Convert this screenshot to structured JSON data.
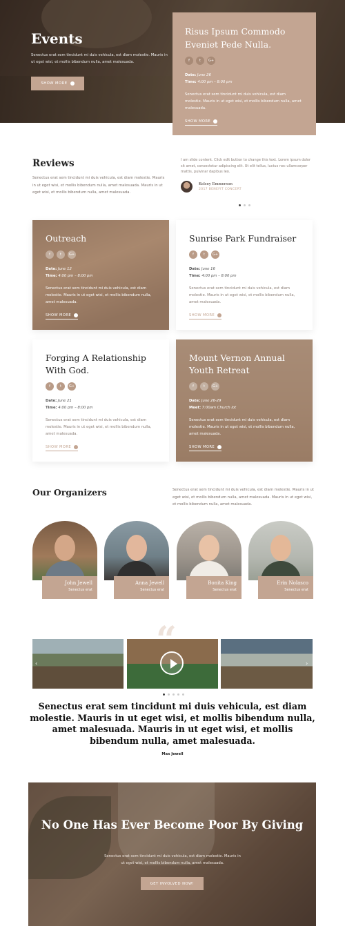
{
  "hero": {
    "title": "Events",
    "text": "Senectus erat sem tincidunt mi duis vehicula, est diam molestie. Mauris in ut eget wisi, et mollis bibendum nulla, amet malesuada.",
    "button": "Show More",
    "card": {
      "title": "Risus Ipsum Commodo Eveniet Pede Nulla.",
      "date_label": "Date:",
      "date": "June 26",
      "time_label": "Time:",
      "time": "4:00 pm – 8:00 pm",
      "text": "Senectus erat sem tincidunt mi duis vehicula, est diam molestie. Mauris in ut eget wisi, et mollis bibendum nulla, amet malesuada.",
      "link": "Show More"
    }
  },
  "reviews": {
    "title": "Reviews",
    "text": "Senectus erat sem tincidunt mi duis vehicula, est diam molestie. Mauris in ut eget wisi, et mollis bibendum nulla, amet malesuada. Mauris in ut eget wisi, et mollis bibendum nulla, amet malesuada.",
    "testimonial": "I am slide content. Click edit button to change this text. Lorem ipsum dolor sit amet, consectetur adipiscing elit. Ut elit tellus, luctus nec ullamcorper mattis, pulvinar dapibus leo.",
    "author_name": "Kelsey Emmerson",
    "author_role": "2017 Benefit Concert"
  },
  "events": [
    {
      "title": "Outreach",
      "date_label": "Date:",
      "date": "June 12",
      "time_label": "Time:",
      "time": "4:00 pm – 8:00 pm",
      "text": "Senectus erat sem tincidunt mi duis vehicula, est diam molestie. Mauris in ut eget wisi, et mollis bibendum nulla, amet malesuada.",
      "link": "Show More"
    },
    {
      "title": "Sunrise Park Fundraiser",
      "date_label": "Date:",
      "date": "June 16",
      "time_label": "Time:",
      "time": "4:00 pm – 8:00 pm",
      "text": "Senectus erat sem tincidunt mi duis vehicula, est diam molestie. Mauris in ut eget wisi, et mollis bibendum nulla, amet malesuada.",
      "link": "Show More"
    },
    {
      "title": "Forging A Relationship With God.",
      "date_label": "Date:",
      "date": "June 21",
      "time_label": "Time:",
      "time": "4:00 pm – 8:00 pm",
      "text": "Senectus erat sem tincidunt mi duis vehicula, est diam molestie. Mauris in ut eget wisi, et mollis bibendum nulla, amet malesuada.",
      "link": "Show More"
    },
    {
      "title": "Mount Vernon Annual Youth Retreat",
      "date_label": "Date:",
      "date": "June 26-29",
      "time_label": "Meet:",
      "time": "7:00am Church lot",
      "text": "Senectus erat sem tincidunt mi duis vehicula, est diam molestie. Mauris in ut eget wisi, et mollis bibendum nulla, amet malesuada.",
      "link": "Show More"
    }
  ],
  "social_icons": {
    "facebook": "f",
    "twitter": "t",
    "google": "G+"
  },
  "organizers": {
    "title": "Our Organizers",
    "text": "Senectus erat sem tincidunt mi duis vehicula, est diam molestie. Mauris in ut eget wisi, et mollis bibendum nulla, amet malesuada. Mauris in ut eget wisi, et mollis bibendum nulla, amet malesuada.",
    "people": [
      {
        "name": "John Jewell",
        "role": "Senectus erat"
      },
      {
        "name": "Anna Jewell",
        "role": "Senectus erat"
      },
      {
        "name": "Bonita King",
        "role": "Senectus erat"
      },
      {
        "name": "Erin Nolasco",
        "role": "Senectus erat"
      }
    ]
  },
  "quote": {
    "mark": "“",
    "text": "Senectus erat sem tincidunt mi duis vehicula, est diam molestie. Mauris in ut eget wisi, et mollis bibendum nulla, amet malesuada. Mauris in ut eget wisi, et mollis bibendum nulla, amet malesuada.",
    "author": "Max Jewell"
  },
  "giving": {
    "title": "No One Has Ever Become Poor By Giving",
    "text": "Senectus erat sem tincidunt mi duis vehicula, est diam molestie. Mauris in ut eget wisi, et mollis bibendum nulla, amet malesuada.",
    "button": "Get Involved Now!"
  },
  "colors": {
    "accent": "#c3a592",
    "text_dark": "#222222",
    "muted": "#8a7d76"
  }
}
